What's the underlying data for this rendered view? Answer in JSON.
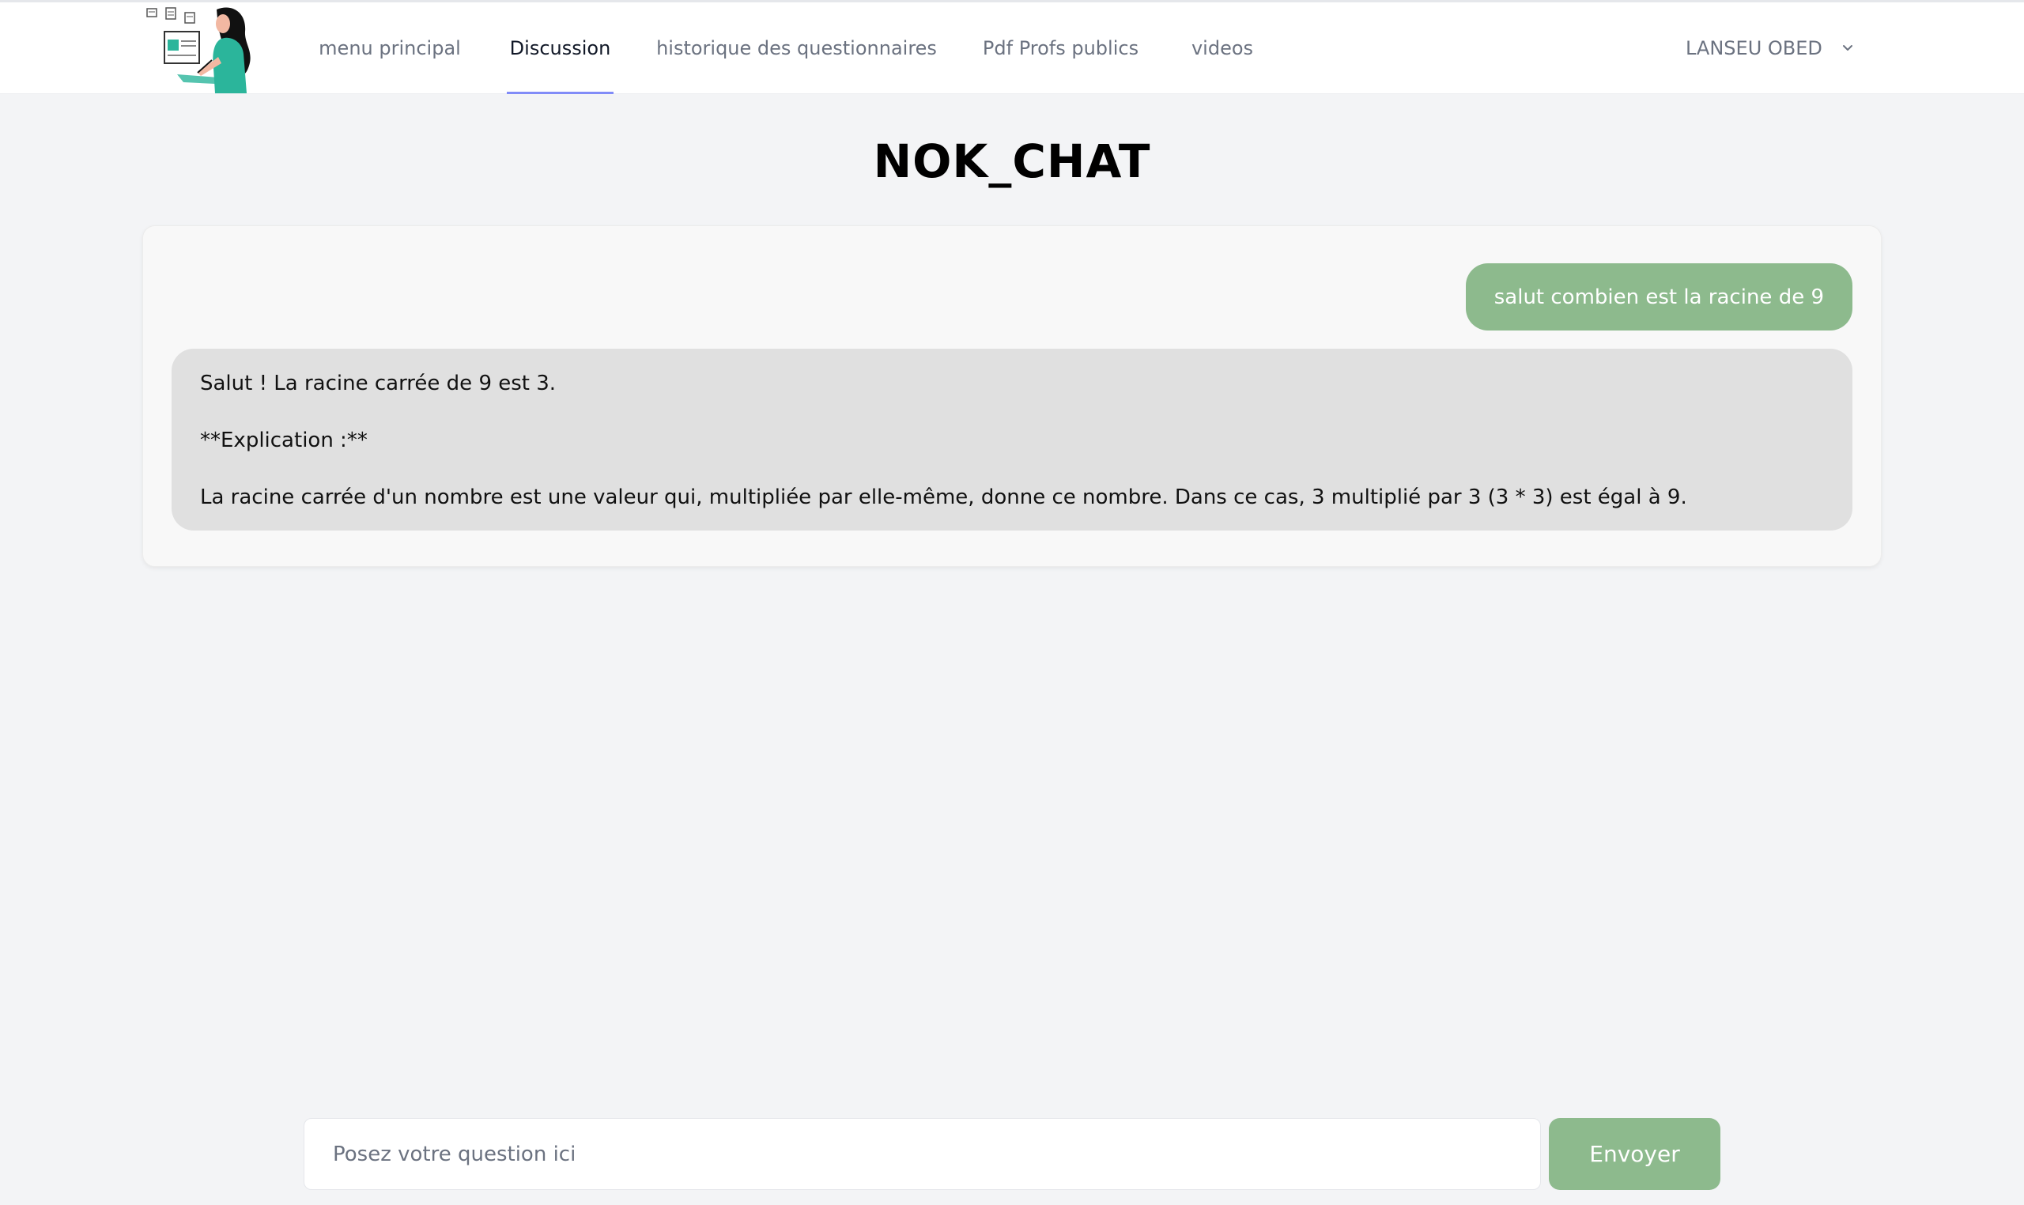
{
  "nav": {
    "items": [
      {
        "label": "menu principal",
        "active": false
      },
      {
        "label": "Discussion",
        "active": true
      },
      {
        "label": "historique des questionnaires",
        "active": false
      },
      {
        "label": "Pdf Profs publics",
        "active": false
      },
      {
        "label": "videos",
        "active": false
      }
    ],
    "user": {
      "name": "LANSEU OBED",
      "icon": "chevron-down-icon"
    }
  },
  "page": {
    "title": "NOK_CHAT"
  },
  "chat": {
    "messages": [
      {
        "role": "user",
        "text": "salut combien est la racine de 9"
      },
      {
        "role": "assistant",
        "lines": [
          "Salut ! La racine carrée de 9 est 3.",
          "**Explication :**",
          "La racine carrée d'un nombre est une valeur qui, multipliée par elle-même, donne ce nombre. Dans ce cas, 3 multiplié par 3 (3 * 3) est égal à 9."
        ]
      }
    ]
  },
  "composer": {
    "placeholder": "Posez votre question ici",
    "value": "",
    "send_label": "Envoyer"
  },
  "colors": {
    "accent_green": "#8dba8d",
    "active_tab_underline": "#818cf8",
    "background": "#f3f4f6"
  }
}
